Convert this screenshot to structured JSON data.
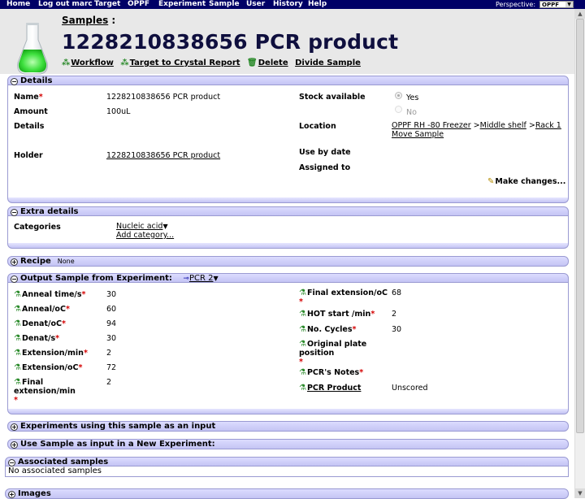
{
  "nav": {
    "items": [
      "Home",
      "Log out marc",
      "Target",
      "OPPF",
      "Experiment",
      "Sample",
      "User",
      "History",
      "Help"
    ],
    "perspective_label": "Perspective:",
    "perspective_value": "OPPF"
  },
  "header": {
    "breadcrumb": "Samples",
    "breadcrumb_sep": ":",
    "title": "1228210838656 PCR product",
    "actions": {
      "workflow": "Workflow",
      "target_report": "Target to Crystal Report",
      "delete": "Delete",
      "divide": "Divide Sample"
    }
  },
  "details": {
    "header": "Details",
    "name_label": "Name",
    "name_value": "1228210838656 PCR product",
    "amount_label": "Amount",
    "amount_value": "100uL",
    "details_label": "Details",
    "holder_label": "Holder",
    "holder_value": "1228210838656 PCR product",
    "stock_label": "Stock available",
    "stock_yes": "Yes",
    "stock_no": "No",
    "location_label": "Location",
    "location_parts": [
      "OPPF RH -80 Freezer",
      ">",
      "Middle shelf",
      ">",
      "Rack 1"
    ],
    "move_sample": "Move Sample",
    "use_by_label": "Use by date",
    "assigned_label": "Assigned to",
    "make_changes": "Make changes..."
  },
  "extra": {
    "header": "Extra details",
    "categories_label": "Categories",
    "category_value": "Nucleic acid",
    "add_category": "Add category..."
  },
  "recipe": {
    "header": "Recipe",
    "note": "None"
  },
  "output": {
    "header": "Output Sample from Experiment:",
    "experiment_link": "PCR 2",
    "left": [
      {
        "label": "Anneal time/s",
        "value": "30"
      },
      {
        "label": "Anneal/oC",
        "value": "60"
      },
      {
        "label": "Denat/oC",
        "value": "94"
      },
      {
        "label": "Denat/s",
        "value": "30"
      },
      {
        "label": "Extension/min",
        "value": "2"
      },
      {
        "label": "Extension/oC",
        "value": "72"
      },
      {
        "label": "Final extension/min",
        "value": "2"
      }
    ],
    "right": [
      {
        "label": "Final extension/oC",
        "value": "68"
      },
      {
        "label": "HOT start /min",
        "value": "2"
      },
      {
        "label": "No. Cycles",
        "value": "30"
      },
      {
        "label": "Original plate position",
        "value": ""
      },
      {
        "label": "PCR's Notes",
        "value": ""
      },
      {
        "label": "PCR Product",
        "value": "Unscored"
      }
    ]
  },
  "experiments_input": {
    "header": "Experiments using this sample as an input"
  },
  "use_sample": {
    "header": "Use Sample as input in a New Experiment:"
  },
  "associated": {
    "header": "Associated samples",
    "empty_text": "No associated samples"
  },
  "images": {
    "header": "Images"
  },
  "colors": {
    "nav_bg": "#000066",
    "title": "#0f0f3e",
    "panel_header": "#c4c4f4",
    "required": "#d40000"
  }
}
